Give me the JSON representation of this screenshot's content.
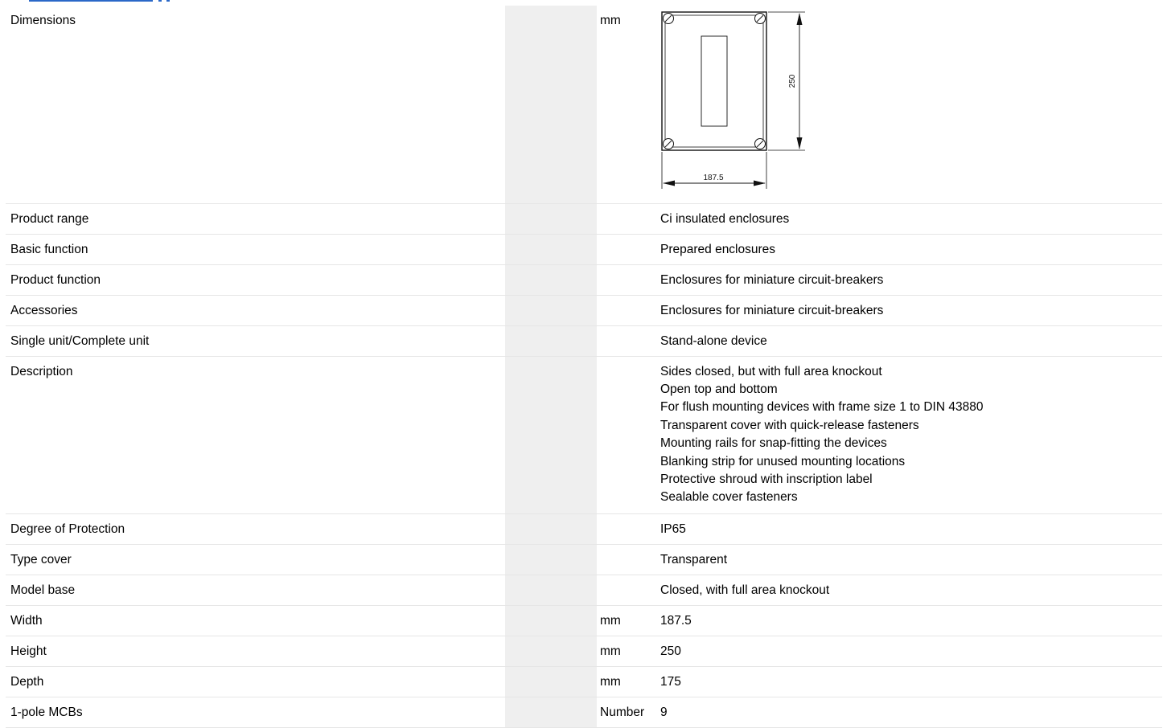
{
  "rows": [
    {
      "label": "Dimensions",
      "unit": "mm",
      "value": ""
    },
    {
      "label": "Product range",
      "unit": "",
      "value": "Ci insulated enclosures"
    },
    {
      "label": "Basic function",
      "unit": "",
      "value": "Prepared enclosures"
    },
    {
      "label": "Product function",
      "unit": "",
      "value": "Enclosures for miniature circuit-breakers"
    },
    {
      "label": "Accessories",
      "unit": "",
      "value": "Enclosures for miniature circuit-breakers"
    },
    {
      "label": "Single unit/Complete unit",
      "unit": "",
      "value": "Stand-alone device"
    },
    {
      "label": "Description",
      "unit": "",
      "value": ""
    },
    {
      "label": "Degree of Protection",
      "unit": "",
      "value": "IP65"
    },
    {
      "label": "Type cover",
      "unit": "",
      "value": "Transparent"
    },
    {
      "label": "Model base",
      "unit": "",
      "value": "Closed, with full area knockout"
    },
    {
      "label": "Width",
      "unit": "mm",
      "value": "187.5"
    },
    {
      "label": "Height",
      "unit": "mm",
      "value": "250"
    },
    {
      "label": "Depth",
      "unit": "mm",
      "value": "175"
    },
    {
      "label": "1-pole MCBs",
      "unit": "Number",
      "value": "9"
    }
  ],
  "description_lines": [
    "Sides closed, but with full area knockout",
    "Open top and bottom",
    "For flush mounting devices with frame size 1 to DIN 43880",
    "Transparent cover with quick-release fasteners",
    "Mounting rails for snap-fitting the devices",
    "Blanking strip for unused mounting locations",
    "Protective shroud with inscription label",
    "Sealable cover fasteners"
  ],
  "drawing": {
    "width_label": "187.5",
    "height_label": "250"
  },
  "colors": {
    "accent": "#2a68c8",
    "unit_column_shade": "#efefef",
    "row_border": "#e6e6e6"
  }
}
